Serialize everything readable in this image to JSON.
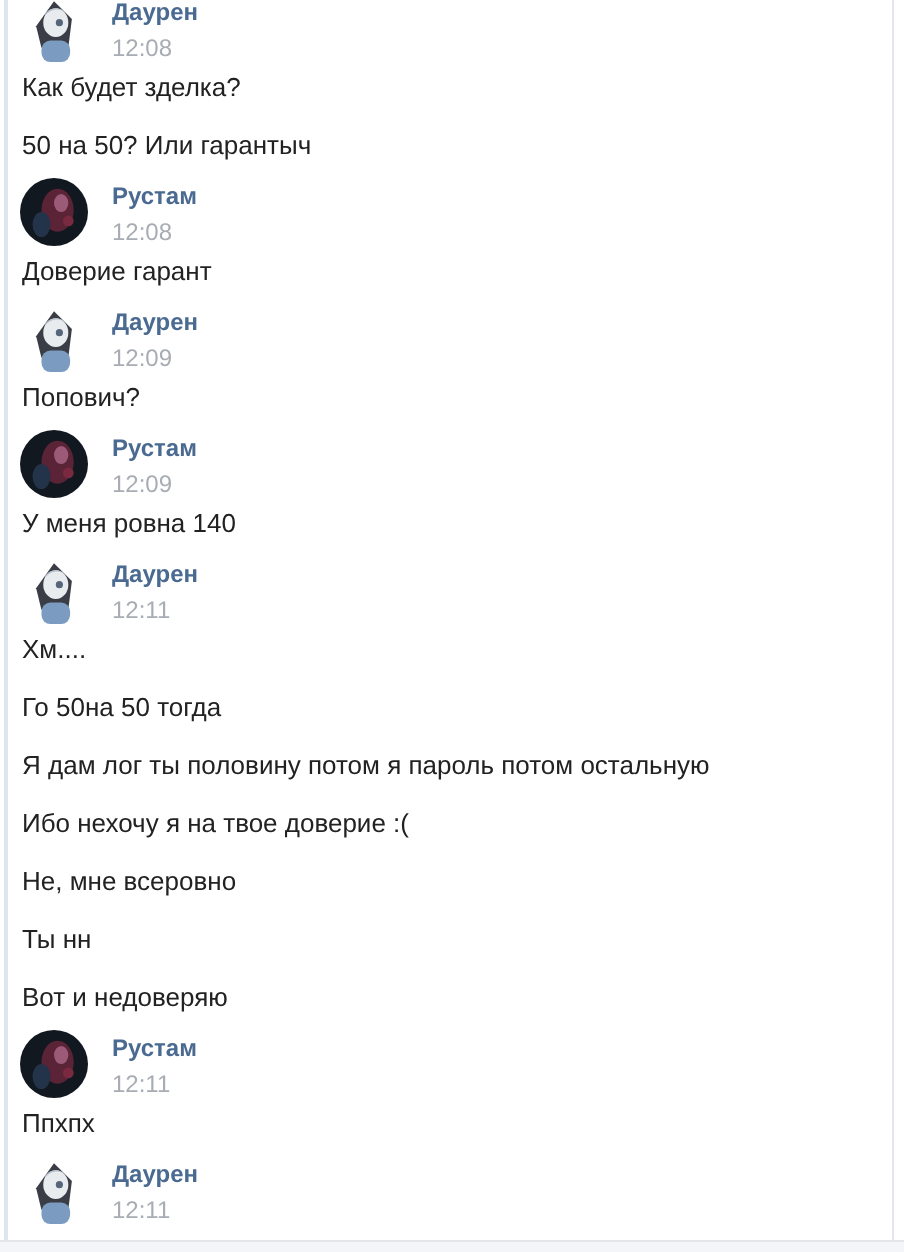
{
  "groups": [
    {
      "author": "Даурен",
      "time": "12:08",
      "avatar": {
        "kind": "anime"
      },
      "messages": [
        "Как будет зделка?",
        "50 на 50? Или гарантыч"
      ]
    },
    {
      "author": "Рустам",
      "time": "12:08",
      "avatar": {
        "kind": "dark"
      },
      "messages": [
        "Доверие гарант"
      ]
    },
    {
      "author": "Даурен",
      "time": "12:09",
      "avatar": {
        "kind": "anime"
      },
      "messages": [
        "Попович?"
      ]
    },
    {
      "author": "Рустам",
      "time": "12:09",
      "avatar": {
        "kind": "dark"
      },
      "messages": [
        "У меня ровна 140"
      ]
    },
    {
      "author": "Даурен",
      "time": "12:11",
      "avatar": {
        "kind": "anime"
      },
      "messages": [
        "Хм....",
        "Го 50на 50 тогда",
        "Я дам лог ты половину потом я пароль потом остальную",
        "Ибо нехочу я на твое доверие :(",
        "Не, мне всеровно",
        "Ты нн",
        "Вот и недоверяю"
      ]
    },
    {
      "author": "Рустам",
      "time": "12:11",
      "avatar": {
        "kind": "dark"
      },
      "messages": [
        "Ппхпх"
      ]
    },
    {
      "author": "Даурен",
      "time": "12:11",
      "avatar": {
        "kind": "anime"
      }
    }
  ]
}
